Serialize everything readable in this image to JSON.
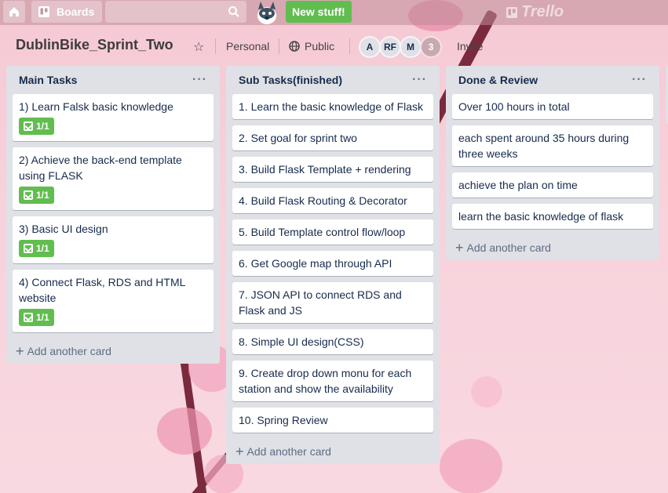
{
  "topbar": {
    "home_icon": "home-icon",
    "boards_label": "Boards",
    "search_icon": "search-icon",
    "new_stuff_label": "New stuff!",
    "logo_text": "Trello",
    "brand_color": "#61bd4f"
  },
  "board": {
    "title": "DublinBike_Sprint_Two",
    "visibility_team": "Personal",
    "visibility": "Public",
    "members": [
      "A",
      "RF",
      "M"
    ],
    "member_count": "3",
    "invite_label": "Invite"
  },
  "lists": [
    {
      "title": "Main Tasks",
      "cards": [
        {
          "title": "1) Learn Falsk basic knowledge",
          "badge": "1/1"
        },
        {
          "title": "2) Achieve the back-end template using FLASK",
          "badge": "1/1"
        },
        {
          "title": "3) Basic UI design",
          "badge": "1/1"
        },
        {
          "title": "4) Connect Flask, RDS and HTML website",
          "badge": "1/1"
        }
      ],
      "add_label": "Add another card"
    },
    {
      "title": "Sub Tasks(finished)",
      "cards": [
        {
          "title": "1. Learn the basic knowledge of Flask"
        },
        {
          "title": "2. Set goal for sprint two"
        },
        {
          "title": "3. Build Flask Template + rendering"
        },
        {
          "title": "4. Build Flask Routing & Decorator"
        },
        {
          "title": "5. Build Template control flow/loop"
        },
        {
          "title": "6. Get Google map through API"
        },
        {
          "title": "7. JSON API to connect RDS and Flask and JS"
        },
        {
          "title": "8. Simple UI design(CSS)"
        },
        {
          "title": "9. Create drop down monu for each station and show the availability"
        },
        {
          "title": "10. Spring Review"
        }
      ],
      "add_label": "Add another card"
    },
    {
      "title": "Done & Review",
      "cards": [
        {
          "title": "Over 100 hours in total"
        },
        {
          "title": "each spent around 35 hours during three weeks"
        },
        {
          "title": "achieve the plan on time"
        },
        {
          "title": "learn the basic knowledge of flask"
        }
      ],
      "add_label": "Add another card"
    }
  ]
}
